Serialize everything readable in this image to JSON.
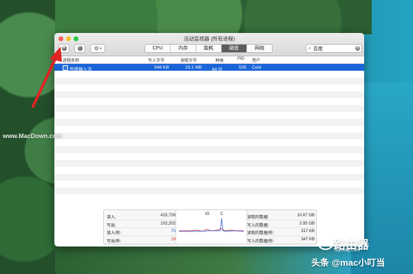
{
  "window": {
    "title": "活动监视器 (所有进程)"
  },
  "tabs": [
    "CPU",
    "内存",
    "能耗",
    "磁盘",
    "网络"
  ],
  "active_tab": "磁盘",
  "search": {
    "value": "百度"
  },
  "columns": [
    "进程名称",
    "写入字节",
    "读取字节",
    "种类",
    "PID",
    "用户"
  ],
  "process": {
    "name": "百度输入法",
    "bytes_written": "948 KB",
    "bytes_read": "23.1 MB",
    "kind": "64 位",
    "pid": "535",
    "user": "Cool"
  },
  "stats_left": [
    {
      "label": "读入:",
      "value": "415,726"
    },
    {
      "label": "写出:",
      "value": "102,202"
    },
    {
      "label": "读入/秒:",
      "value": "70"
    },
    {
      "label": "写出/秒:",
      "value": "19"
    }
  ],
  "graph": {
    "label_left": "IO",
    "label_right": "C"
  },
  "stats_right": [
    {
      "label": "读取的数据:",
      "value": "10.67 GB"
    },
    {
      "label": "写入的数据:",
      "value": "2.95 GB"
    },
    {
      "label": "读取的数据/秒:",
      "value": "317 KB"
    },
    {
      "label": "写入的数据/秒:",
      "value": "347 KB"
    }
  ],
  "watermarks": {
    "macdown": "www.MacDown.com",
    "router_name": "路由器",
    "router_site": "luyouqi.com",
    "toutiao": "头条 @mac小叮当"
  },
  "colors": {
    "selection": "#1a64d6",
    "accent_arrow": "#e02424"
  }
}
